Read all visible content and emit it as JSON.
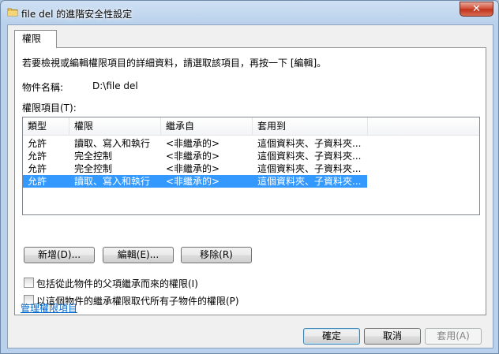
{
  "window": {
    "title": "file del 的進階安全性設定",
    "close_glyph": "✕"
  },
  "tab": {
    "label": "權限"
  },
  "panel": {
    "instructions": "若要檢視或編輯權限項目的詳細資料，請選取該項目，再按一下 [編輯]。",
    "object_name_label": "物件名稱:",
    "object_name_value": "D:\\file del",
    "entries_label": "權限項目(T):"
  },
  "permission_list": {
    "columns": [
      "類型",
      "權限",
      "繼承自",
      "套用到"
    ],
    "rows": [
      {
        "type": "允許",
        "permission": "讀取、寫入和執行",
        "inherited_from": "<非繼承的>",
        "apply_to": "這個資料夾、子資料夾...",
        "selected": false
      },
      {
        "type": "允許",
        "permission": "完全控制",
        "inherited_from": "<非繼承的>",
        "apply_to": "這個資料夾、子資料夾...",
        "selected": false
      },
      {
        "type": "允許",
        "permission": "完全控制",
        "inherited_from": "<非繼承的>",
        "apply_to": "這個資料夾、子資料夾...",
        "selected": false
      },
      {
        "type": "允許",
        "permission": "讀取、寫入和執行",
        "inherited_from": "<非繼承的>",
        "apply_to": "這個資料夾、子資料夾...",
        "selected": true
      }
    ]
  },
  "buttons": {
    "add": "新增(D)...",
    "edit": "編輯(E)...",
    "remove": "移除(R)"
  },
  "checkboxes": {
    "include_inheritable": {
      "label": "包括從此物件的父項繼承而來的權限(I)",
      "checked": false
    },
    "replace_child": {
      "label": "以這個物件的繼承權限取代所有子物件的權限(P)",
      "checked": false
    }
  },
  "manage_link": "管理權限項目",
  "footer": {
    "ok": "確定",
    "cancel": "取消",
    "apply": "套用(A)"
  },
  "colors": {
    "selection": "#3399ff",
    "link": "#0066cc"
  }
}
